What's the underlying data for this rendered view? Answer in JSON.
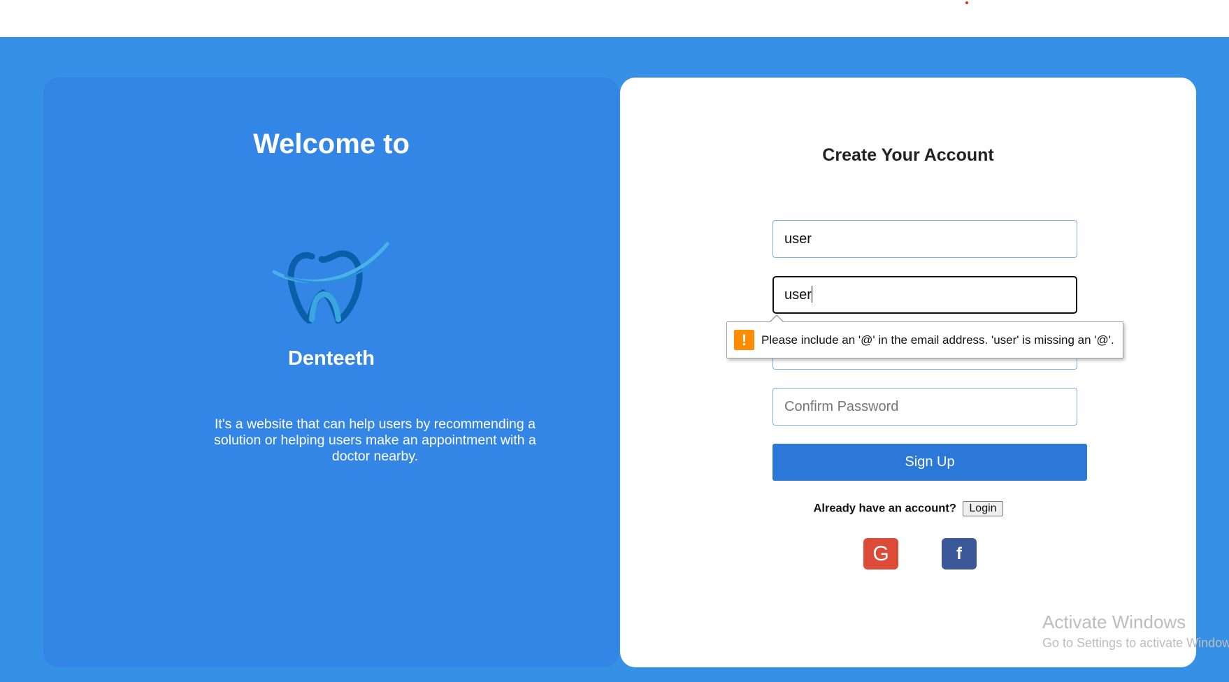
{
  "left_panel": {
    "welcome_title": "Welcome to",
    "logo_icon": "tooth-logo-icon",
    "brand_name": "Denteeth",
    "description": "It's a website that can help users by recommending a solution or helping users make an appointment with a doctor nearby."
  },
  "form": {
    "title": "Create Your Account",
    "username_value": "user",
    "email_value": "user",
    "confirm_password_placeholder": "Confirm Password",
    "signup_label": "Sign Up",
    "already_text": "Already have an account?",
    "login_label": "Login",
    "google_label": "G",
    "facebook_label": "f"
  },
  "validation_tooltip": {
    "icon": "warning-icon",
    "message": "Please include an '@' in the email address. 'user' is missing an '@'."
  },
  "watermark": {
    "title": "Activate Windows",
    "subtitle": "Go to Settings to activate Windows."
  },
  "colors": {
    "page_background": "#3690e6",
    "left_panel": "#3385e6",
    "signup_button": "#2b78d8",
    "google": "#dd4b39",
    "facebook": "#3b5998",
    "warning": "#ff8c00"
  }
}
